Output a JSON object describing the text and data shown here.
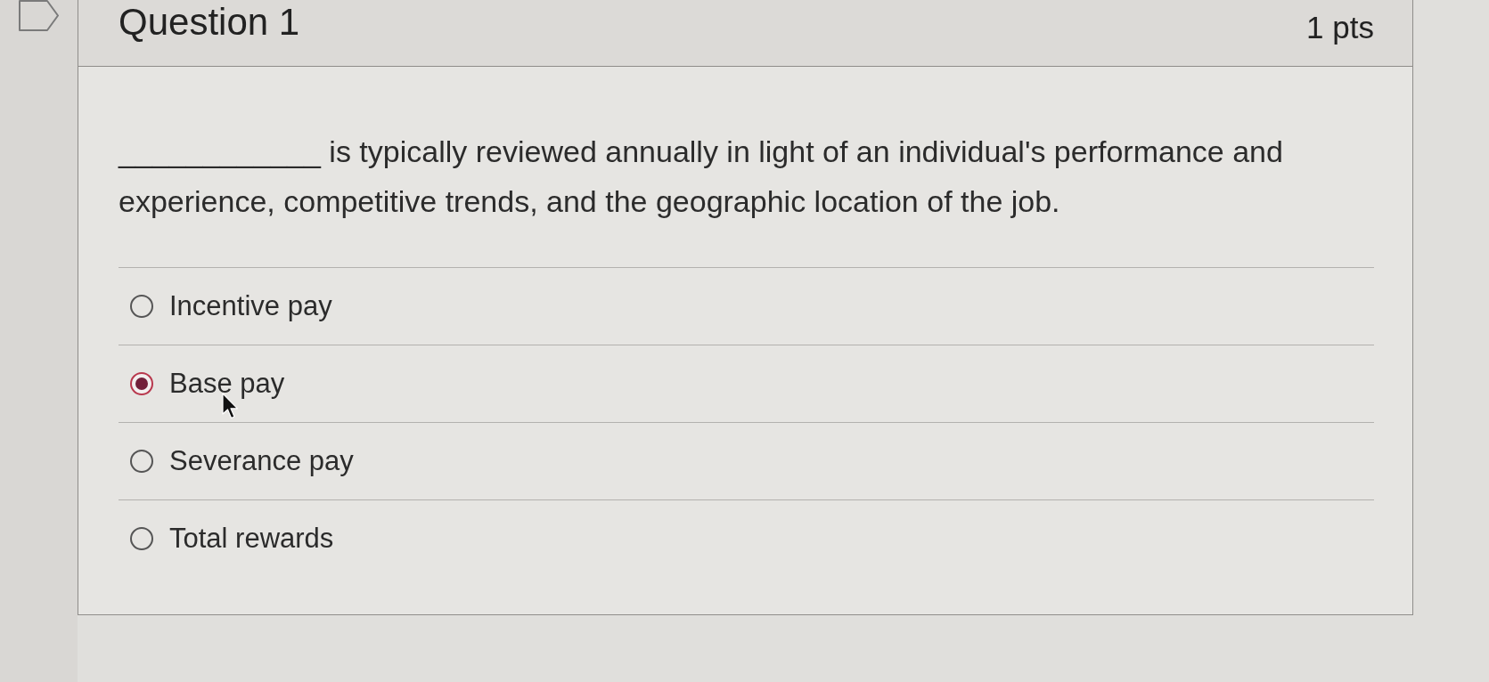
{
  "question": {
    "flagged": false,
    "title": "Question 1",
    "points": "1 pts",
    "text": "____________ is typically reviewed annually in light of an individual's performance and experience, competitive trends, and the geographic location of the job.",
    "options": [
      {
        "label": "Incentive pay",
        "selected": false
      },
      {
        "label": "Base pay",
        "selected": true
      },
      {
        "label": "Severance pay",
        "selected": false
      },
      {
        "label": "Total rewards",
        "selected": false
      }
    ]
  }
}
